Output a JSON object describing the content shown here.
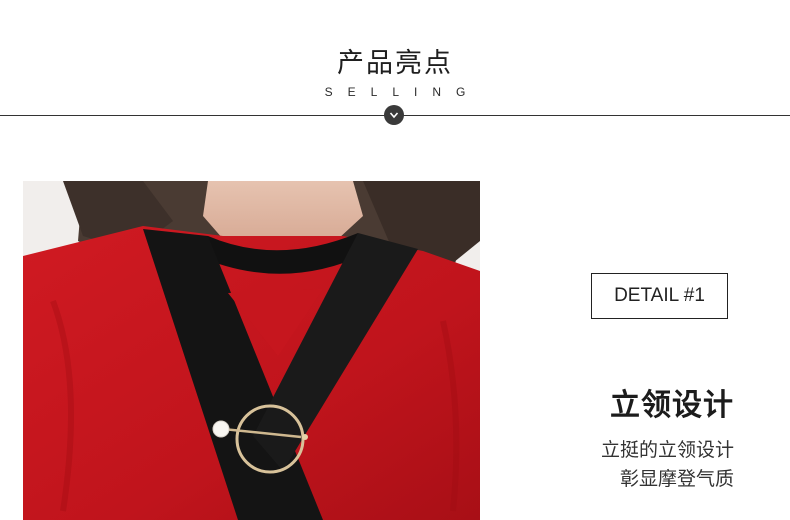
{
  "header": {
    "title": "产品亮点",
    "subtitle": "SELLING"
  },
  "detail": {
    "label": "DETAIL #1",
    "feature_title": "立领设计",
    "description_lines": [
      "立挺的立领设计",
      "彰显摩登气质"
    ]
  },
  "colors": {
    "accent_dark": "#3a3a3a",
    "garment_red": "#c4151c",
    "collar_black": "#111111"
  },
  "icons": {
    "divider_badge": "chevron-down-icon"
  }
}
